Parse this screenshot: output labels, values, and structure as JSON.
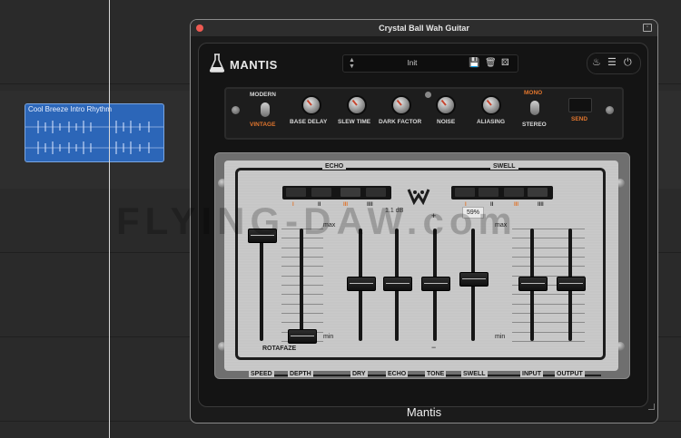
{
  "daw": {
    "region_title": "Cool Breeze Intro Rhythm"
  },
  "window": {
    "title": "Crystal Ball Wah Guitar",
    "footer": "Mantis"
  },
  "plugin": {
    "brand": "MANTIS",
    "preset": "Init",
    "controls": {
      "modern_label": "MODERN",
      "vintage_label": "VINTAGE",
      "knobs": [
        "BASE DELAY",
        "SLEW TIME",
        "DARK FACTOR",
        "NOISE",
        "ALIASING"
      ],
      "mono_label": "MONO",
      "stereo_label": "STEREO",
      "send_label": "SEND"
    },
    "panel": {
      "echo_label": "ECHO",
      "swell_label": "SWELL",
      "echo_ticks": [
        "I",
        "II",
        "III",
        "IIII"
      ],
      "swell_ticks": [
        "I",
        "II",
        "III",
        "IIII"
      ],
      "readout_db": "1.1 dB",
      "readout_pct": "59%",
      "max_label": "max",
      "min_label": "min",
      "plus_label": "+",
      "minus_label": "−",
      "rotafaze_label": "ROTAFAZE",
      "fader_labels": [
        "SPEED",
        "DEPTH",
        "DRY",
        "ECHO",
        "TONE",
        "SWELL",
        "INPUT",
        "OUTPUT"
      ],
      "fader_levels": [
        0.94,
        0.05,
        0.52,
        0.52,
        0.52,
        0.56,
        0.52,
        0.52
      ]
    },
    "icons": [
      "flask-icon",
      "save-icon",
      "trash-icon",
      "dice-icon",
      "bell-icon",
      "menu-icon",
      "power-icon"
    ]
  },
  "watermark": "FLYING-DAW.com",
  "colors": {
    "accent_orange": "#e0752d",
    "region_blue": "#2c66b8",
    "close_red": "#ee5a52"
  }
}
